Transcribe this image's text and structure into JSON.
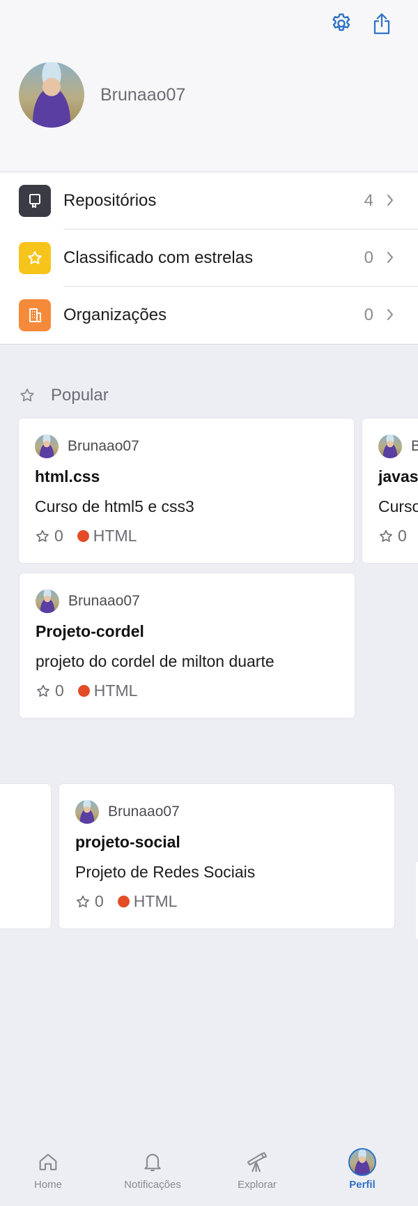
{
  "header": {
    "username": "Brunaao07",
    "settings_icon": "gear-icon",
    "share_icon": "share-icon"
  },
  "menu": [
    {
      "label": "Repositórios",
      "count": "4",
      "icon": "repo-icon",
      "color": "#3a3b44"
    },
    {
      "label": "Classificado com estrelas",
      "count": "0",
      "icon": "star-icon",
      "color": "#f7c41c"
    },
    {
      "label": "Organizações",
      "count": "0",
      "icon": "building-icon",
      "color": "#f58b3a"
    }
  ],
  "popular": {
    "title": "Popular",
    "cards": [
      {
        "owner": "Brunaao07",
        "name": "html.css",
        "description": "Curso de html5 e css3",
        "stars": "0",
        "language": "HTML",
        "language_color": "#e34c26"
      },
      {
        "owner": "B",
        "name": "javas",
        "description": "Curso",
        "stars": "0"
      },
      {
        "owner": "Brunaao07",
        "name": "Projeto-cordel",
        "description": "projeto do cordel de milton duarte",
        "stars": "0",
        "language": "HTML",
        "language_color": "#e34c26"
      },
      {
        "owner": "Brunaao07",
        "name": "projeto-social",
        "description": "Projeto de Redes Sociais",
        "stars": "0",
        "language": "HTML",
        "language_color": "#e34c26"
      }
    ]
  },
  "tabbar": {
    "items": [
      {
        "label": "Home",
        "icon": "home-icon"
      },
      {
        "label": "Notificações",
        "icon": "bell-icon"
      },
      {
        "label": "Explorar",
        "icon": "telescope-icon"
      },
      {
        "label": "Perfil",
        "icon": "avatar",
        "active": true
      }
    ],
    "active_color": "#2f73c4"
  }
}
